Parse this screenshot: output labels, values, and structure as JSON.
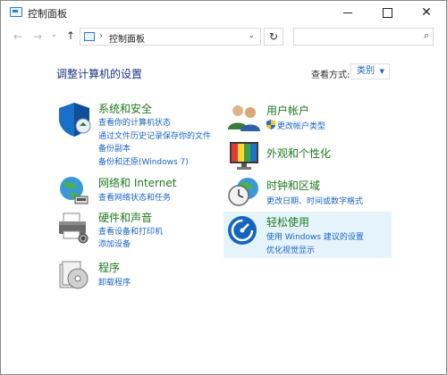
{
  "window": {
    "title": "控制面板"
  },
  "address": {
    "path": "控制面板"
  },
  "main": {
    "heading": "调整计算机的设置",
    "view_label": "查看方式:",
    "view_value": "类别"
  },
  "categories": [
    {
      "title": "系统和安全",
      "links": [
        "查看你的计算机状态",
        "通过文件历史记录保存你的文件",
        "备份副本",
        "备份和还原(Windows 7)"
      ]
    },
    {
      "title": "网络和 Internet",
      "links": [
        "查看网络状态和任务"
      ]
    },
    {
      "title": "硬件和声音",
      "links": [
        "查看设备和打印机",
        "添加设备"
      ]
    },
    {
      "title": "程序",
      "links": [
        "卸载程序"
      ]
    },
    {
      "title": "用户帐户",
      "links": [
        "更改帐户类型"
      ]
    },
    {
      "title": "外观和个性化",
      "links": []
    },
    {
      "title": "时钟和区域",
      "links": [
        "更改日期、时间或数字格式"
      ]
    },
    {
      "title": "轻松使用",
      "links": [
        "使用 Windows 建议的设置",
        "优化视觉显示"
      ]
    }
  ],
  "icons": [
    "control-panel-icon",
    "shield-icon",
    "network-globe-icon",
    "printer-icon",
    "programs-disc-icon",
    "users-icon",
    "uac-shield-icon",
    "monitor-icon",
    "clock-globe-icon",
    "ease-of-access-icon",
    "search-icon",
    "refresh-icon"
  ],
  "colors": {
    "link": "#1a64c8",
    "category_title": "#1f7a1f",
    "heading": "#1e3287",
    "highlight": "#e5f3fb"
  }
}
